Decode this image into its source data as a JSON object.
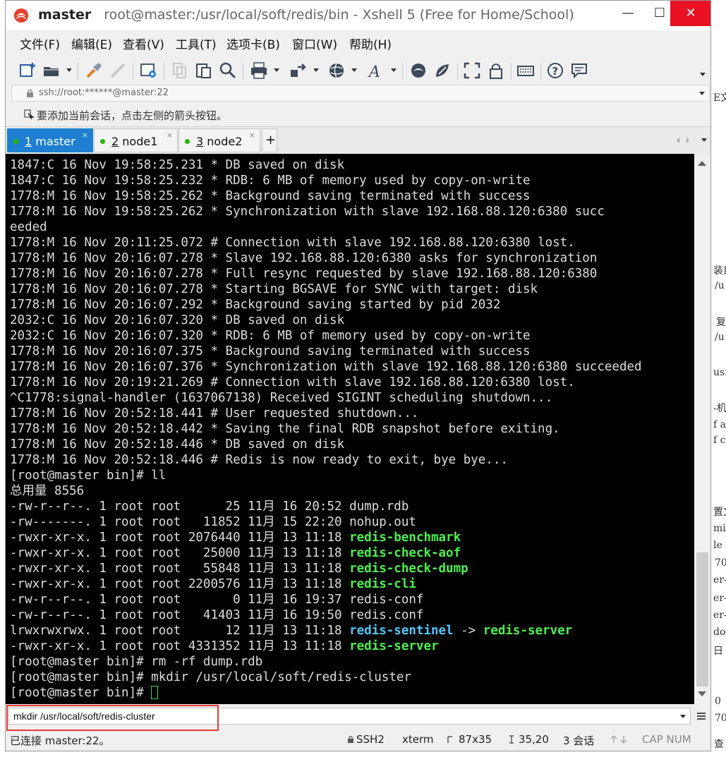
{
  "window": {
    "app_name": "master",
    "title": "root@master:/usr/local/soft/redis/bin - Xshell 5 (Free for Home/School)",
    "minimize_glyph": "—",
    "maximize_glyph": "☐",
    "close_glyph": "✕"
  },
  "menu": [
    "文件(F)",
    "编辑(E)",
    "查看(V)",
    "工具(T)",
    "选项卡(B)",
    "窗口(W)",
    "帮助(H)"
  ],
  "address": {
    "text": "ssh://root:******@master:22"
  },
  "hint": {
    "text": "要添加当前会话，点击左侧的箭头按钮。"
  },
  "tabs": [
    {
      "num": "1",
      "name": "master",
      "close": "×",
      "active": true
    },
    {
      "num": "2",
      "name": "node1",
      "close": "×",
      "active": false
    },
    {
      "num": "3",
      "name": "node2",
      "close": "×",
      "active": false
    }
  ],
  "tab_add": "+",
  "terminal": {
    "lines": [
      "1847:C 16 Nov 19:58:25.231 * DB saved on disk",
      "1847:C 16 Nov 19:58:25.232 * RDB: 6 MB of memory used by copy-on-write",
      "1778:M 16 Nov 19:58:25.262 * Background saving terminated with success",
      "1778:M 16 Nov 19:58:25.262 * Synchronization with slave 192.168.88.120:6380 succ",
      "eeded",
      "1778:M 16 Nov 20:11:25.072 # Connection with slave 192.168.88.120:6380 lost.",
      "1778:M 16 Nov 20:16:07.278 * Slave 192.168.88.120:6380 asks for synchronization",
      "1778:M 16 Nov 20:16:07.278 * Full resync requested by slave 192.168.88.120:6380",
      "1778:M 16 Nov 20:16:07.278 * Starting BGSAVE for SYNC with target: disk",
      "1778:M 16 Nov 20:16:07.292 * Background saving started by pid 2032",
      "2032:C 16 Nov 20:16:07.320 * DB saved on disk",
      "2032:C 16 Nov 20:16:07.320 * RDB: 6 MB of memory used by copy-on-write",
      "1778:M 16 Nov 20:16:07.375 * Background saving terminated with success",
      "1778:M 16 Nov 20:16:07.376 * Synchronization with slave 192.168.88.120:6380 succeeded",
      "1778:M 16 Nov 20:19:21.269 # Connection with slave 192.168.88.120:6380 lost.",
      "^C1778:signal-handler (1637067138) Received SIGINT scheduling shutdown...",
      "1778:M 16 Nov 20:52:18.441 # User requested shutdown...",
      "1778:M 16 Nov 20:52:18.442 * Saving the final RDB snapshot before exiting.",
      "1778:M 16 Nov 20:52:18.446 * DB saved on disk",
      "1778:M 16 Nov 20:52:18.446 # Redis is now ready to exit, bye bye...",
      "[root@master bin]# ll",
      "总用量 8556"
    ],
    "listing": [
      {
        "meta": "-rw-r--r--. 1 root root      25 11月 16 20:52 ",
        "name": "dump.rdb",
        "style": "plain"
      },
      {
        "meta": "-rw-------. 1 root root   11852 11月 15 22:20 ",
        "name": "nohup.out",
        "style": "plain"
      },
      {
        "meta": "-rwxr-xr-x. 1 root root 2076440 11月 13 11:18 ",
        "name": "redis-benchmark",
        "style": "green"
      },
      {
        "meta": "-rwxr-xr-x. 1 root root   25000 11月 13 11:18 ",
        "name": "redis-check-aof",
        "style": "green"
      },
      {
        "meta": "-rwxr-xr-x. 1 root root   55848 11月 13 11:18 ",
        "name": "redis-check-dump",
        "style": "green"
      },
      {
        "meta": "-rwxr-xr-x. 1 root root 2200576 11月 13 11:18 ",
        "name": "redis-cli",
        "style": "green"
      },
      {
        "meta": "-rw-r--r--. 1 root root       0 11月 16 19:37 ",
        "name": "redis-conf",
        "style": "plain"
      },
      {
        "meta": "-rw-r--r--. 1 root root   41403 11月 16 19:50 ",
        "name": "redis.conf",
        "style": "plain"
      },
      {
        "meta": "lrwxrwxrwx. 1 root root      12 11月 13 11:18 ",
        "name": "redis-sentinel",
        "style": "cyan",
        "arrow": " -> ",
        "target": "redis-server"
      },
      {
        "meta": "-rwxr-xr-x. 1 root root 4331352 11月 13 11:18 ",
        "name": "redis-server",
        "style": "green"
      }
    ],
    "tail_lines": [
      "[root@master bin]# rm -rf dump.rdb",
      "[root@master bin]# mkdir /usr/local/soft/redis-cluster"
    ],
    "prompt": "[root@master bin]# "
  },
  "compose": {
    "value": "mkdir /usr/local/soft/redis-cluster"
  },
  "status": {
    "connection": "已连接 master:22。",
    "protocol": "SSH2",
    "term_type": "xterm",
    "size": "87x35",
    "cursor_pos": "35,20",
    "sessions": "3 会话",
    "caps": "CAP NUM"
  },
  "background_fragments": [
    "E文",
    "装目",
    "/u",
    "复",
    "/u",
    "usr",
    "-机",
    "f a",
    "f c",
    "置文",
    "mize",
    "le",
    "70",
    "er-",
    "er-",
    "er-",
    "dor",
    "日",
    "0",
    "70",
    "查"
  ],
  "colors": {
    "terminal_bg": "#000000",
    "terminal_fg": "#dcdcdc",
    "exec_green": "#4cf04c",
    "link_cyan": "#4ec9ff",
    "tab_active": "#1e7fd0",
    "close_red": "#e81123",
    "highlight_red": "#e53935"
  }
}
